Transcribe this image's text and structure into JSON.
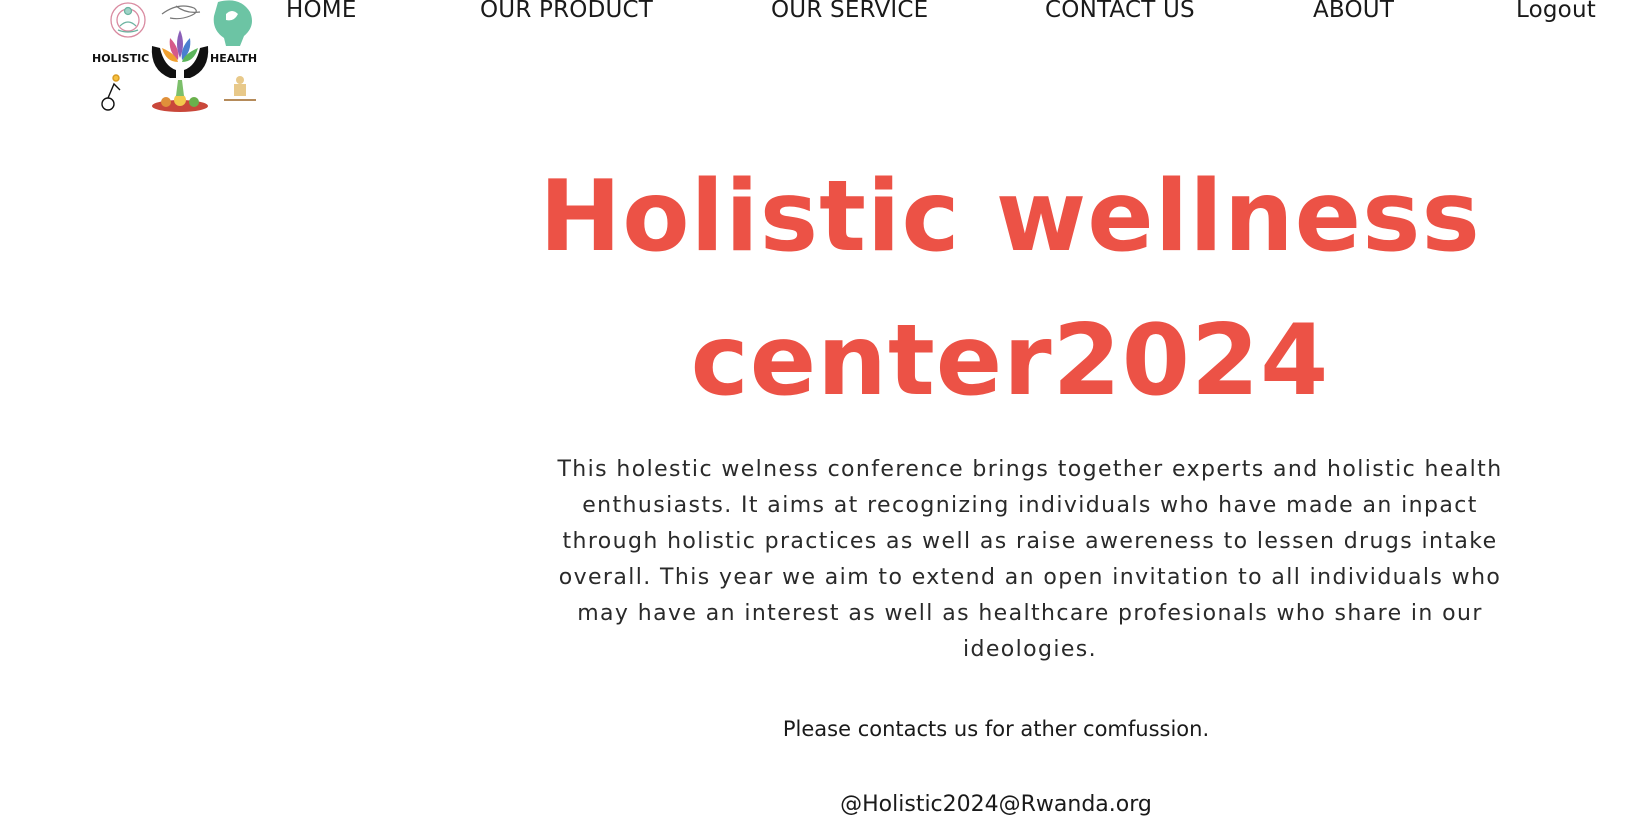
{
  "brand": {
    "logo_left_text": "HOLISTIC",
    "logo_right_text": "HEALTH"
  },
  "nav": {
    "home": "HOME",
    "product": "OUR PRODUCT",
    "service": "OUR SERVICE",
    "contact": "CONTACT US",
    "about": "ABOUT",
    "logout": "Logout"
  },
  "hero": {
    "title": "Holistic wellness center2024",
    "description": "This holestic welness conference brings together experts and holistic health enthusiasts. It aims at recognizing individuals who have made an inpact through holistic practices as well as raise awereness to lessen drugs intake overall. This year we aim to extend an open invitation to all individuals who may have an interest as well as healthcare profesionals who share in our ideologies.",
    "contact_note": "Please contacts us for ather comfussion.",
    "email": "@Holistic2024@Rwanda.org"
  },
  "colors": {
    "accent": "#ec5246",
    "text": "#1a1a1a",
    "background": "#ffffff"
  }
}
